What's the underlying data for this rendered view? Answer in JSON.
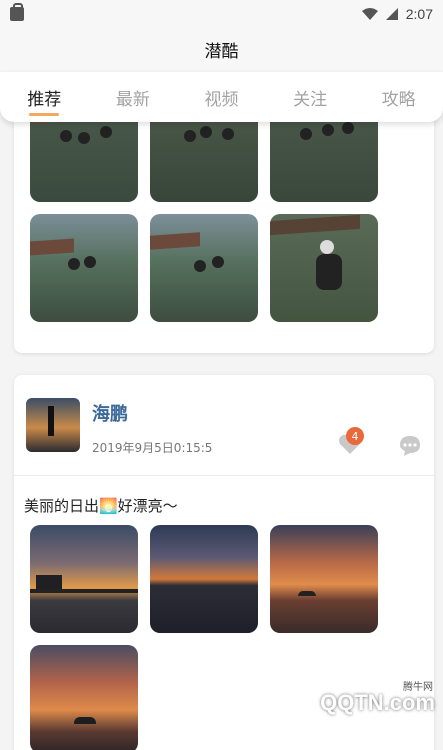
{
  "status": {
    "time": "2:07"
  },
  "app": {
    "title": "潜酷"
  },
  "tabs": [
    {
      "label": "推荐",
      "active": true
    },
    {
      "label": "最新",
      "active": false
    },
    {
      "label": "视频",
      "active": false
    },
    {
      "label": "关注",
      "active": false
    },
    {
      "label": "攻略",
      "active": false
    }
  ],
  "post": {
    "author": "海鹏",
    "time": "2019年9月5日0:15:5",
    "likes": "4",
    "text": "美丽的日出🌅好漂亮～"
  },
  "watermark": {
    "logo": "QQTN.com",
    "site": "腾牛网"
  },
  "colors": {
    "accent": "#f2a85e",
    "author": "#3d6a99",
    "badge": "#e86a3a"
  }
}
